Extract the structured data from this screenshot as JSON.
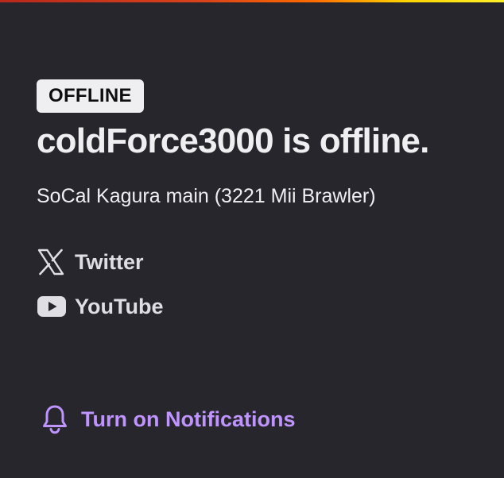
{
  "status": {
    "badge": "OFFLINE",
    "title": "coldForce3000 is offline.",
    "description": "SoCal Kagura main (3221 Mii Brawler)"
  },
  "social_links": [
    {
      "label": "Twitter",
      "icon": "x-twitter-icon"
    },
    {
      "label": "YouTube",
      "icon": "youtube-icon"
    }
  ],
  "notifications": {
    "label": "Turn on Notifications",
    "icon": "bell-icon"
  },
  "colors": {
    "background": "#26262c",
    "text": "#efeff1",
    "accent": "#bf94ff",
    "badge_bg": "#efeff1"
  }
}
